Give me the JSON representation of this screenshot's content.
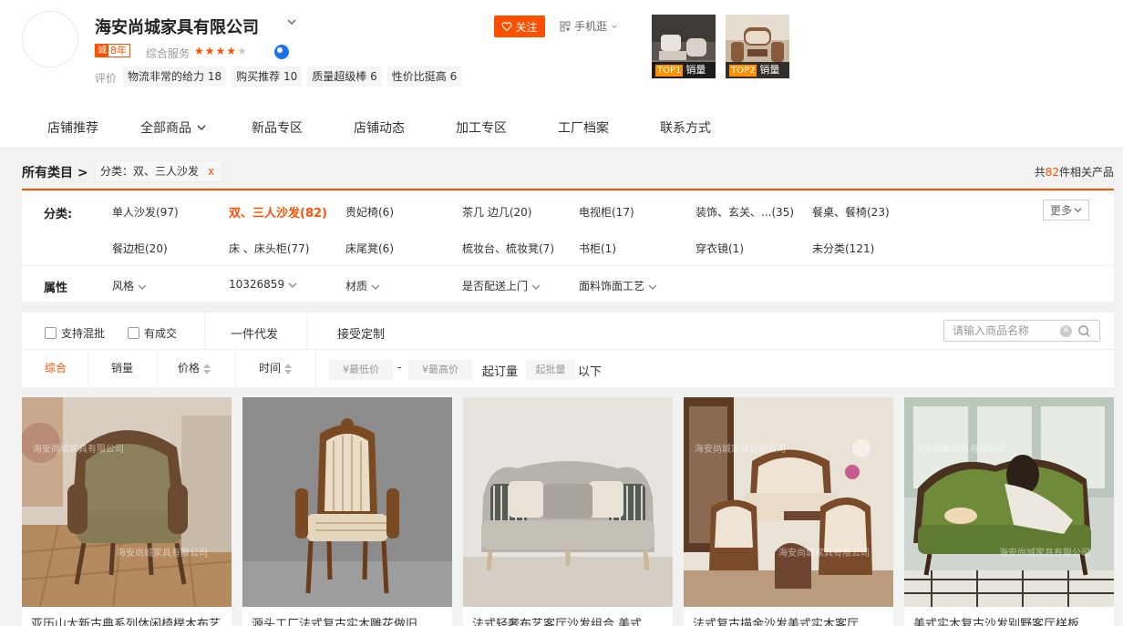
{
  "shop": {
    "name": "海安尚城家具有限公司",
    "years": "8年",
    "years_icon": "诚",
    "service_label": "综合服务",
    "rating_stars": 4,
    "review_label": "评价",
    "tags": [
      {
        "text": "物流非常的给力",
        "count": "18"
      },
      {
        "text": "购买推荐",
        "count": "10"
      },
      {
        "text": "质量超级棒",
        "count": "6"
      },
      {
        "text": "性价比挺高",
        "count": "6"
      }
    ],
    "follow_label": "关注",
    "mobile_label": "手机逛"
  },
  "top_items": [
    {
      "rank": "TOP1",
      "label": "销量"
    },
    {
      "rank": "TOP2",
      "label": "销量"
    }
  ],
  "nav": [
    {
      "label": "店铺推荐"
    },
    {
      "label": "全部商品"
    },
    {
      "label": "新品专区"
    },
    {
      "label": "店铺动态"
    },
    {
      "label": "加工专区"
    },
    {
      "label": "工厂档案"
    },
    {
      "label": "联系方式"
    }
  ],
  "breadcrumb": {
    "root": "所有类目 >",
    "chip": "分类：双、三人沙发",
    "chip_close": "x",
    "total_prefix": "共",
    "total_count": "82",
    "total_suffix": "件相关产品"
  },
  "filter": {
    "category_label": "分类:",
    "categories": [
      "单人沙发(97)",
      "双、三人沙发(82)",
      "贵妃椅(6)",
      "茶几 边几(20)",
      "电视柜(17)",
      "装饰、玄关、...(35)",
      "餐桌、餐椅(23)",
      "餐边柜(20)",
      "床 、床头柜(77)",
      "床尾凳(6)",
      "梳妆台、梳妆凳(7)",
      "书柜(1)",
      "穿衣镜(1)",
      "未分类(121)"
    ],
    "more_label": "更多",
    "attr_label": "属性",
    "attributes": [
      "风格",
      "10326859",
      "材质",
      "是否配送上门",
      "面料饰面工艺"
    ]
  },
  "toolbar": {
    "mix_label": "支持混批",
    "deal_label": "有成交",
    "dropship_label": "一件代发",
    "custom_label": "接受定制",
    "search_placeholder": "请输入商品名称",
    "sort_comprehensive": "综合",
    "sort_sales": "销量",
    "sort_price": "价格",
    "sort_time": "时间",
    "min_price": "¥最低价",
    "dash": "-",
    "max_price": "¥最高价",
    "min_order_label": "起订量",
    "min_batch": "起批量",
    "below_label": "以下"
  },
  "watermark": "海安尚城家具有限公司",
  "products": [
    {
      "title": "亚历山大新古典系列休闲椅榉木布艺"
    },
    {
      "title": "源头工厂法式复古实木雕花做旧"
    },
    {
      "title": "法式轻奢布艺客厅沙发组合 美式"
    },
    {
      "title": "法式复古描金沙发美式实木客厅"
    },
    {
      "title": "美式实木复古沙发别野客厅样板"
    }
  ]
}
